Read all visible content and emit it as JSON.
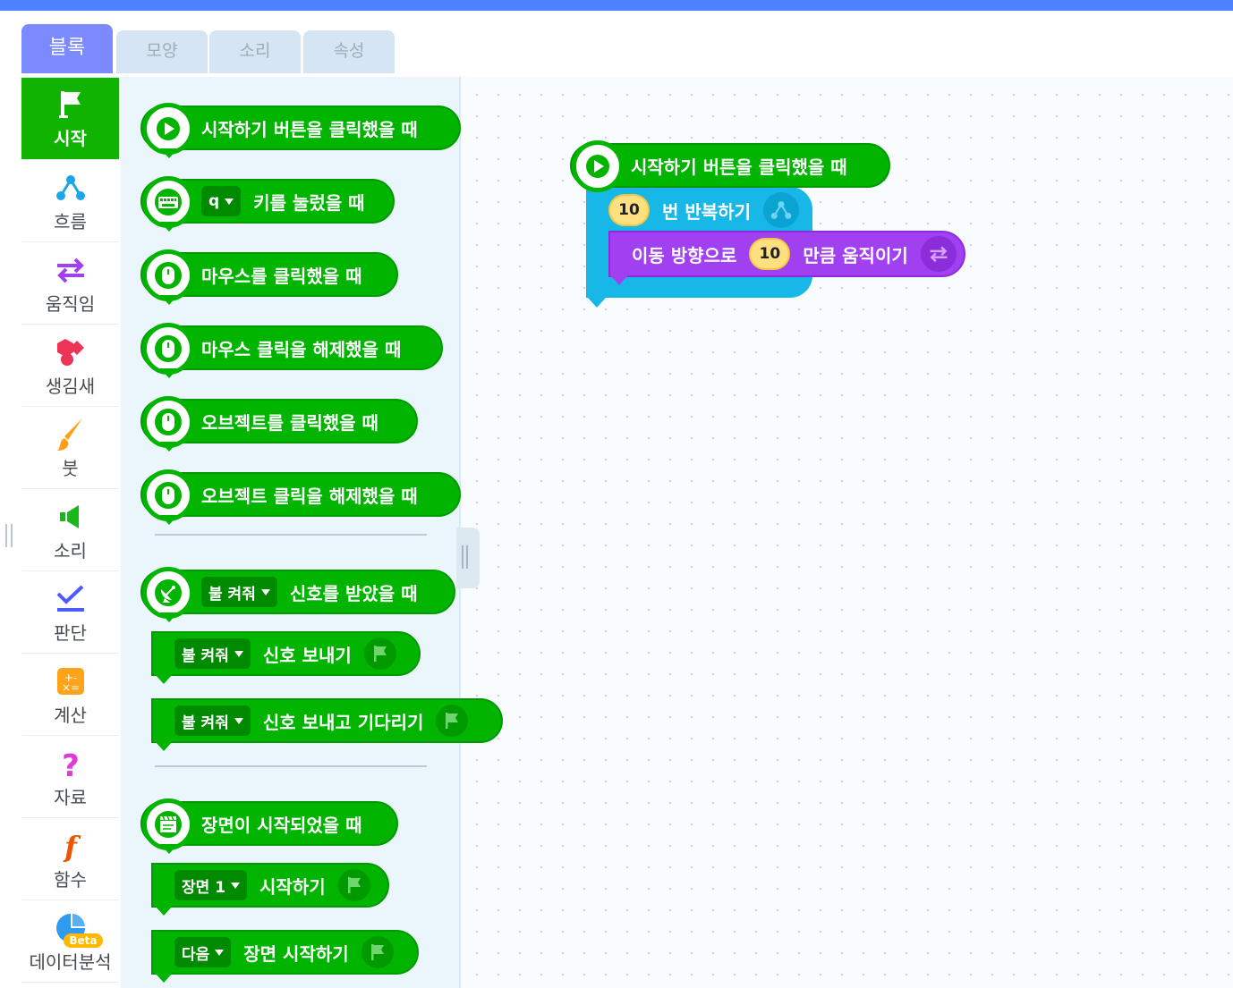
{
  "tabs": [
    {
      "label": "블록",
      "active": true
    },
    {
      "label": "모양",
      "active": false
    },
    {
      "label": "소리",
      "active": false
    },
    {
      "label": "속성",
      "active": false
    }
  ],
  "categories": [
    {
      "label": "시작",
      "icon": "flag-icon",
      "active": true
    },
    {
      "label": "흐름",
      "icon": "flow-icon"
    },
    {
      "label": "움직임",
      "icon": "move-arrows-icon"
    },
    {
      "label": "생김새",
      "icon": "shapes-icon"
    },
    {
      "label": "붓",
      "icon": "brush-icon"
    },
    {
      "label": "소리",
      "icon": "speaker-icon"
    },
    {
      "label": "판단",
      "icon": "check-icon"
    },
    {
      "label": "계산",
      "icon": "calculator-icon"
    },
    {
      "label": "자료",
      "icon": "question-icon"
    },
    {
      "label": "함수",
      "icon": "function-icon"
    },
    {
      "label": "데이터분석",
      "icon": "pie-chart-icon",
      "badge": "Beta"
    }
  ],
  "palette": {
    "start_click": "시작하기 버튼을 클릭했을 때",
    "key_value": "q",
    "key_pressed": "키를 눌렀을 때",
    "mouse_click": "마우스를 클릭했을 때",
    "mouse_release": "마우스 클릭을 해제했을 때",
    "object_click": "오브젝트를 클릭했을 때",
    "object_release": "오브젝트 클릭을 해제했을 때",
    "signal_value": "불 켜줘",
    "signal_received": "신호를 받았을 때",
    "signal_send": "신호 보내기",
    "signal_send_wait": "신호 보내고 기다리기",
    "scene_started": "장면이 시작되었을 때",
    "scene_value": "장면 1",
    "scene_start": "시작하기",
    "next_value": "다음",
    "scene_start_next": "장면 시작하기"
  },
  "workspace": {
    "hat_label": "시작하기 버튼을 클릭했을 때",
    "repeat_count": "10",
    "repeat_label": "번 반복하기",
    "move_prefix": "이동 방향으로",
    "move_amount": "10",
    "move_suffix": "만큼 움직이기"
  },
  "colors": {
    "accent": "#4f80ff",
    "start_green": "#00b400",
    "flow_blue": "#17b8e8",
    "move_purple": "#a040f0",
    "active_tab": "#7b8bff"
  }
}
